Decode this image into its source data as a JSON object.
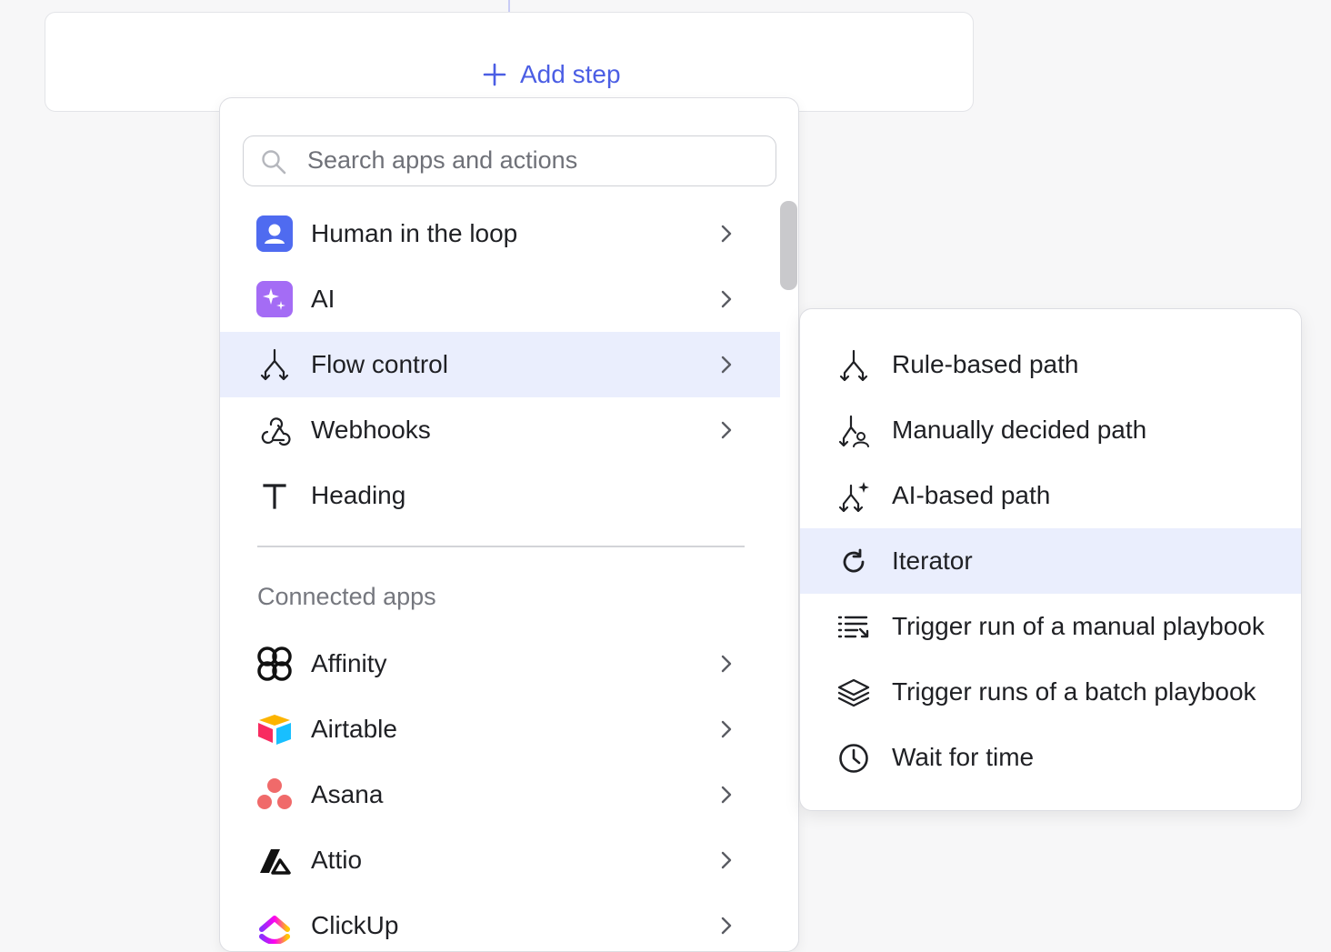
{
  "add_step": {
    "label": "Add step",
    "icon": "plus-icon"
  },
  "search": {
    "placeholder": "Search apps and actions",
    "value": ""
  },
  "menu": {
    "top_items": [
      {
        "label": "Human in the loop",
        "icon": "person-icon",
        "has_submenu": true
      },
      {
        "label": "AI",
        "icon": "sparkle-icon",
        "has_submenu": true
      },
      {
        "label": "Flow control",
        "icon": "branch-icon",
        "has_submenu": true,
        "active": true
      },
      {
        "label": "Webhooks",
        "icon": "webhook-icon",
        "has_submenu": true
      },
      {
        "label": "Heading",
        "icon": "text-t-icon",
        "has_submenu": false
      }
    ],
    "section_label": "Connected apps",
    "apps": [
      {
        "label": "Affinity",
        "icon": "affinity-logo"
      },
      {
        "label": "Airtable",
        "icon": "airtable-logo"
      },
      {
        "label": "Asana",
        "icon": "asana-logo"
      },
      {
        "label": "Attio",
        "icon": "attio-logo"
      },
      {
        "label": "ClickUp",
        "icon": "clickup-logo"
      }
    ]
  },
  "submenu": {
    "items": [
      {
        "label": "Rule-based path",
        "icon": "branch-icon"
      },
      {
        "label": "Manually decided path",
        "icon": "branch-person-icon"
      },
      {
        "label": "AI-based path",
        "icon": "branch-sparkle-icon"
      },
      {
        "label": "Iterator",
        "icon": "refresh-icon",
        "active": true
      },
      {
        "label": "Trigger run of a manual playbook",
        "icon": "list-arrow-icon"
      },
      {
        "label": "Trigger runs of a batch playbook",
        "icon": "layers-icon"
      },
      {
        "label": "Wait for time",
        "icon": "clock-icon"
      }
    ]
  },
  "colors": {
    "accent": "#4b5ee4",
    "active_bg": "#eaeefd",
    "human_icon_bg": "#4f6bf0",
    "ai_icon_bg": "#a46cf5"
  }
}
